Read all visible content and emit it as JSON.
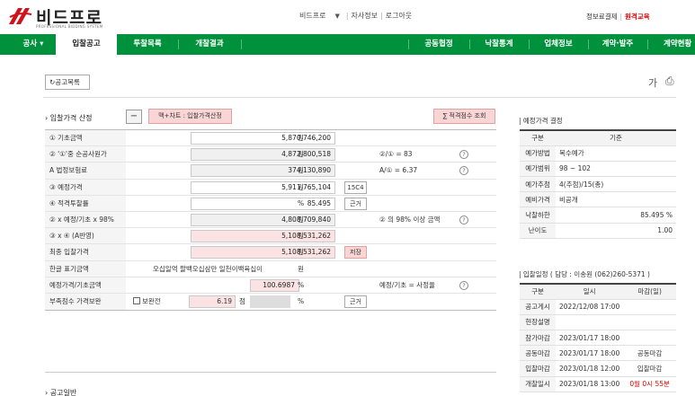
{
  "header": {
    "logo_text": "비드프로",
    "logo_sub": "PROFESSIONAL BIDDING SYSTEM",
    "user_name": "비드프로",
    "links": [
      "자사정보",
      "로그아웃"
    ],
    "right_link_1": "정보료결제",
    "right_link_2": "원격교육"
  },
  "nav": {
    "menu_label": "공사",
    "items": [
      "입찰공고",
      "투찰목록",
      "개찰결과",
      "공동협정",
      "낙찰통계",
      "업체정보",
      "계약·발주",
      "계약현황"
    ],
    "accent": "#00913c"
  },
  "toolbar": {
    "list_button": "공고목록",
    "font_button": "가",
    "print_icon": "printer-icon"
  },
  "calc": {
    "title": "입찰가격 산정",
    "minus": "−",
    "chart_button": "맥+차트 : 입찰가격산정",
    "score_button": "∑ 적격점수 조회",
    "rows": {
      "base": {
        "label": "① 기초금액",
        "value": "5,870,746,200",
        "unit": "원"
      },
      "net": {
        "label": "② '①'중 순공사원가",
        "value": "4,872,800,518",
        "unit": "원",
        "note": "②/① = 83"
      },
      "legal": {
        "label": "A 법정보험료",
        "value": "374,130,890",
        "unit": "원",
        "note": "A/① = 6.37"
      },
      "estimate": {
        "label": "③ 예정가격",
        "value": "5,911,765,104",
        "unit": "원",
        "btn": "15C4"
      },
      "rate": {
        "label": "④ 적격투찰률",
        "value": "85.495",
        "unit": "%",
        "btn": "근거"
      },
      "x98": {
        "label": "② x 예정/기초 x 98%",
        "value": "4,808,709,840",
        "unit": "원",
        "note": "② 의 98% 이상 금액"
      },
      "x4": {
        "label": "③ x ④ (A반영)",
        "value": "5,108,531,262",
        "unit": "원"
      },
      "final": {
        "label": "최종 입찰가격",
        "value": "5,108,531,262",
        "unit": "원",
        "btn": "저장"
      },
      "korean": {
        "label": "한글 표기금액",
        "value": "오십일억 팔백오십삼만 일천이백육십이",
        "unit": "원"
      },
      "ratio": {
        "label": "예정가격/기초금액",
        "value": "100.6987",
        "unit": "%",
        "note": "예정/기초 = 사정율"
      },
      "deficit": {
        "label": "부족점수 가격보완",
        "check": "보완전",
        "score": "6.19",
        "score_unit": "점",
        "unit": "%",
        "btn": "근거"
      }
    },
    "help": "?"
  },
  "notice": {
    "title": "공고일반"
  },
  "estimate_panel": {
    "title": "| 예정가격 결정",
    "head": [
      "구분",
      "기준"
    ],
    "rows": [
      [
        "예가방법",
        "복수예가"
      ],
      [
        "예가범위",
        "98 ~ 102"
      ],
      [
        "예가추첨",
        "4(추첨)/15(총)"
      ],
      [
        "예비가격",
        "비공개"
      ],
      [
        "낙찰하한",
        "85.495 %"
      ],
      [
        "난이도",
        "1.00"
      ]
    ]
  },
  "schedule_panel": {
    "title": "| 입찰일정 ( 담당 : 이송원 (062)260-5371 )",
    "head": [
      "구분",
      "일시",
      "마감(일)"
    ],
    "rows": [
      [
        "공고게시",
        "2022/12/08 17:00",
        ""
      ],
      [
        "현장설명",
        "",
        ""
      ],
      [
        "참가마감",
        "2023/01/17 18:00",
        ""
      ],
      [
        "공동마감",
        "2023/01/17 18:00",
        "공동마감"
      ],
      [
        "입찰마감",
        "2023/01/18 12:00",
        "입찰마감"
      ],
      [
        "개찰일시",
        "2023/01/18 13:00",
        "0월 0시 55분"
      ]
    ]
  }
}
